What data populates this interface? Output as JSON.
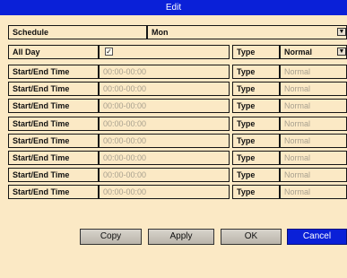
{
  "window": {
    "title": "Edit"
  },
  "schedule": {
    "label": "Schedule",
    "value": "Mon"
  },
  "all_day": {
    "label": "All Day",
    "checked_glyph": "✓"
  },
  "type_header": {
    "label": "Type",
    "value": "Normal"
  },
  "rows": [
    {
      "label": "Start/End Time",
      "time": "00:00-00:00",
      "type_label": "Type",
      "type_value": "Normal"
    },
    {
      "label": "Start/End Time",
      "time": "00:00-00:00",
      "type_label": "Type",
      "type_value": "Normal"
    },
    {
      "label": "Start/End Time",
      "time": "00:00-00:00",
      "type_label": "Type",
      "type_value": "Normal"
    },
    {
      "label": "Start/End Time",
      "time": "00:00-00:00",
      "type_label": "Type",
      "type_value": "Normal"
    },
    {
      "label": "Start/End Time",
      "time": "00:00-00:00",
      "type_label": "Type",
      "type_value": "Normal"
    },
    {
      "label": "Start/End Time",
      "time": "00:00-00:00",
      "type_label": "Type",
      "type_value": "Normal"
    },
    {
      "label": "Start/End Time",
      "time": "00:00-00:00",
      "type_label": "Type",
      "type_value": "Normal"
    },
    {
      "label": "Start/End Time",
      "time": "00:00-00:00",
      "type_label": "Type",
      "type_value": "Normal"
    }
  ],
  "buttons": {
    "copy": "Copy",
    "apply": "Apply",
    "ok": "OK",
    "cancel": "Cancel"
  },
  "colors": {
    "panel": "#fbe9c5",
    "accent": "#0a20d8"
  }
}
